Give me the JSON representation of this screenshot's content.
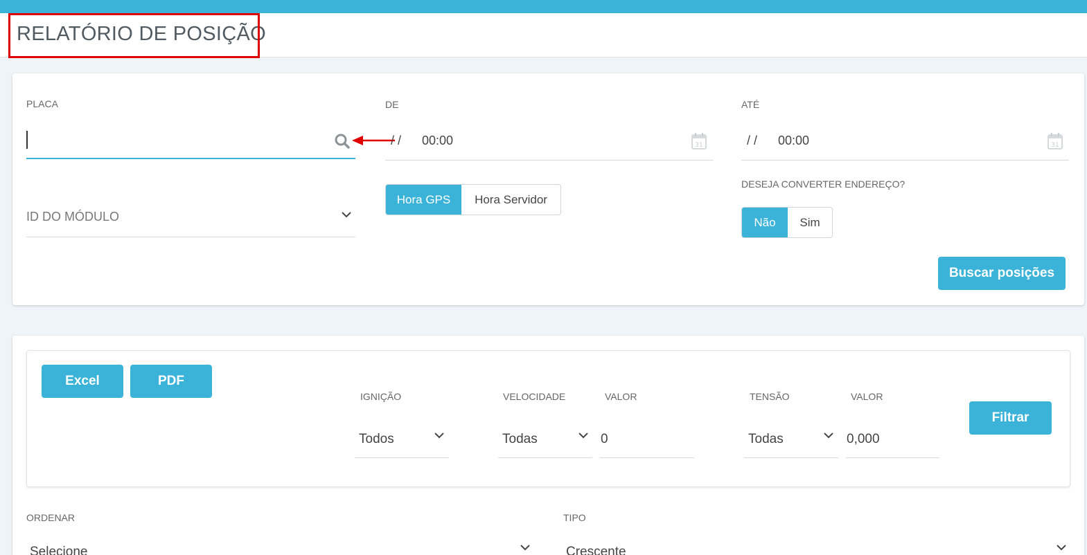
{
  "header": {
    "title": "RELATÓRIO DE POSIÇÃO"
  },
  "colors": {
    "accent": "#3bb3d8",
    "highlight_box": "#e00000",
    "arrow": "#e00000"
  },
  "search_form": {
    "placa": {
      "label": "PLACA",
      "value": "",
      "icon": "search-icon"
    },
    "de": {
      "label": "DE",
      "date": "/ /",
      "time": "00:00",
      "icon": "calendar-icon"
    },
    "ate": {
      "label": "ATÉ",
      "date": "/ /",
      "time": "00:00",
      "icon": "calendar-icon"
    },
    "modulo": {
      "placeholder": "ID DO MÓDULO"
    },
    "hora_toggle": {
      "options": [
        "Hora GPS",
        "Hora Servidor"
      ],
      "selected": "Hora GPS"
    },
    "converter": {
      "label": "DESEJA CONVERTER ENDEREÇO?",
      "options": [
        "Não",
        "Sim"
      ],
      "selected": "Não"
    },
    "search_button": "Buscar posições"
  },
  "filters": {
    "export_buttons": [
      "Excel",
      "PDF"
    ],
    "ignicao": {
      "label": "IGNIÇÃO",
      "value": "Todos"
    },
    "velocidade": {
      "label": "VELOCIDADE",
      "value": "Todas"
    },
    "velocidade_valor": {
      "label": "VALOR",
      "value": "0"
    },
    "tensao": {
      "label": "TENSÃO",
      "value": "Todas"
    },
    "tensao_valor": {
      "label": "VALOR",
      "value": "0,000"
    },
    "filter_button": "Filtrar"
  },
  "sort": {
    "ordenar": {
      "label": "ORDENAR",
      "value": "Selecione"
    },
    "tipo": {
      "label": "TIPO",
      "value": "Crescente"
    }
  }
}
